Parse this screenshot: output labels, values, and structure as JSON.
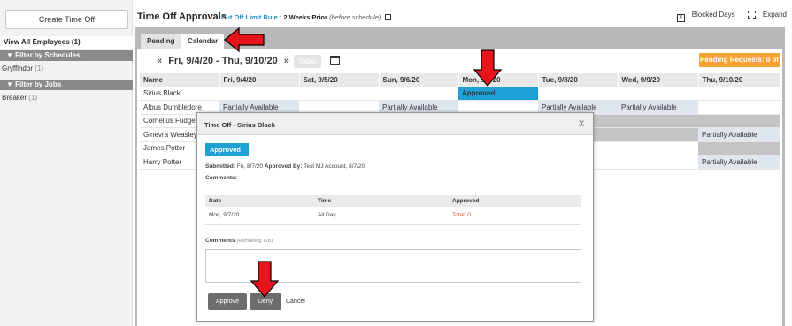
{
  "sidebar": {
    "create_label": "Create Time Off",
    "view_all": "View All Employees (1)",
    "filters": [
      {
        "heading": "▼ Filter by Schedules",
        "item": "Gryffindor",
        "count": "(1)"
      },
      {
        "heading": "▼ Filter by Jobs",
        "item": "Breaker",
        "count": "(1)"
      }
    ]
  },
  "header": {
    "title": "Time Off Approvals",
    "cutoff_link": "Cut Off Limit Rule",
    "cutoff_value": ": 2 Weeks Prior",
    "cutoff_note": "(before schedule)",
    "blocked_days": "Blocked Days",
    "expand": "Expand"
  },
  "tabs": {
    "pending": "Pending",
    "calendar": "Calendar"
  },
  "calendar": {
    "prev_arrow": "«",
    "next_arrow": "»",
    "range": "Fri, 9/4/20 - Thu, 9/10/20",
    "today_label": "Today",
    "pending_requests": "Pending Requests: 0 of 0",
    "columns": [
      "Name",
      "Fri, 9/4/20",
      "Sat, 9/5/20",
      "Sun, 9/6/20",
      "Mon, 9/7/20",
      "Tue, 9/8/20",
      "Wed, 9/9/20",
      "Thu, 9/10/20"
    ],
    "rows": [
      {
        "name": "Sirius Black",
        "cells": [
          "",
          "",
          "",
          "Approved",
          "",
          "",
          ""
        ]
      },
      {
        "name": "Albus Dumbledore",
        "cells": [
          "Partially Available",
          "",
          "Partially Available",
          "",
          "Partially Available",
          "Partially Available",
          ""
        ]
      },
      {
        "name": "Cornelius Fudge",
        "cells": [
          "",
          "",
          "",
          "",
          "",
          "",
          ""
        ]
      },
      {
        "name": "Ginevra Weasley",
        "cells": [
          "",
          "",
          "",
          "",
          "",
          "",
          "Partially Available"
        ]
      },
      {
        "name": "James Potter",
        "cells": [
          "",
          "",
          "",
          "",
          "",
          "",
          ""
        ]
      },
      {
        "name": "Harry Potter",
        "cells": [
          "",
          "",
          "",
          "",
          "",
          "",
          "Partially Available"
        ]
      }
    ]
  },
  "modal": {
    "title": "Time Off - Sirius Black",
    "close": "X",
    "status": "Approved",
    "submitted_label": "Submitted:",
    "submitted_value": "Fri, 8/7/20",
    "approved_by_label": "Approved By:",
    "approved_by_value": "Test MJ Account, 8/7/20",
    "comments_label": "Comments:",
    "comments_value": "-",
    "table_headers": [
      "Date",
      "Time",
      "Approved"
    ],
    "table_rows": [
      {
        "date": "Mon, 9/7/20",
        "time": "All Day",
        "approved": "Total: 0"
      }
    ],
    "comments_input_label": "Comments",
    "comments_remaining": "(Remaining 128)",
    "approve": "Approve",
    "deny": "Deny",
    "cancel": "Cancel"
  },
  "colors": {
    "approved": "#1fa0d6",
    "pending_requests": "#f8a232",
    "annotation_arrow": "#e8141b",
    "link": "#1a8fd0"
  }
}
